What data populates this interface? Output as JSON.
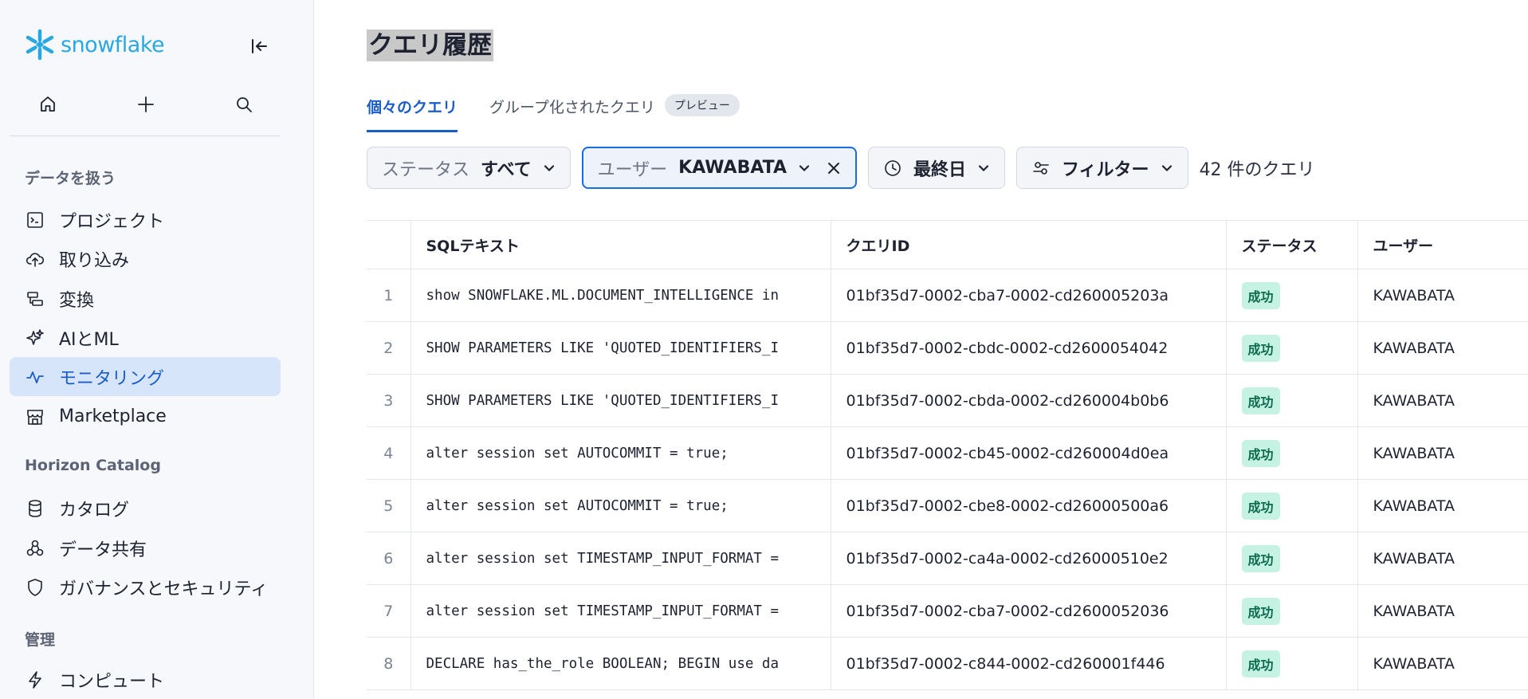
{
  "brand": {
    "name": "snowflake",
    "color": "#29a8e0"
  },
  "sidebar": {
    "quick_icons": [
      "home-icon",
      "plus-icon",
      "search-icon"
    ],
    "sections": [
      {
        "label": "データを扱う"
      },
      {
        "label": "Horizon Catalog"
      },
      {
        "label": "管理"
      }
    ],
    "items": [
      {
        "label": "プロジェクト",
        "icon": "terminal-icon"
      },
      {
        "label": "取り込み",
        "icon": "cloud-upload-icon"
      },
      {
        "label": "変換",
        "icon": "transform-icon"
      },
      {
        "label": "AIとML",
        "icon": "sparkle-icon"
      },
      {
        "label": "モニタリング",
        "icon": "activity-icon",
        "active": true
      },
      {
        "label": "Marketplace",
        "icon": "store-icon"
      },
      {
        "label": "カタログ",
        "icon": "database-icon"
      },
      {
        "label": "データ共有",
        "icon": "share-icon"
      },
      {
        "label": "ガバナンスとセキュリティ",
        "icon": "shield-icon"
      },
      {
        "label": "コンピュート",
        "icon": "lightning-icon"
      }
    ]
  },
  "page": {
    "title": "クエリ履歴"
  },
  "tabs": [
    {
      "label": "個々のクエリ",
      "active": true
    },
    {
      "label": "グループ化されたクエリ",
      "badge": "プレビュー"
    }
  ],
  "filters": {
    "status": {
      "key": "ステータス",
      "value": "すべて"
    },
    "user": {
      "key": "ユーザー",
      "value": "KAWABATA"
    },
    "date": {
      "value": "最終日"
    },
    "more": {
      "value": "フィルター"
    },
    "count": "42 件のクエリ"
  },
  "table": {
    "headers": {
      "sql": "SQLテキスト",
      "id": "クエリID",
      "status": "ステータス",
      "user": "ユーザー"
    },
    "rows": [
      {
        "n": "1",
        "sql": "show SNOWFLAKE.ML.DOCUMENT_INTELLIGENCE in",
        "id": "01bf35d7-0002-cba7-0002-cd260005203a",
        "status": "成功",
        "user": "KAWABATA"
      },
      {
        "n": "2",
        "sql": "SHOW PARAMETERS LIKE 'QUOTED_IDENTIFIERS_I",
        "id": "01bf35d7-0002-cbdc-0002-cd2600054042",
        "status": "成功",
        "user": "KAWABATA"
      },
      {
        "n": "3",
        "sql": "SHOW PARAMETERS LIKE 'QUOTED_IDENTIFIERS_I",
        "id": "01bf35d7-0002-cbda-0002-cd260004b0b6",
        "status": "成功",
        "user": "KAWABATA"
      },
      {
        "n": "4",
        "sql": "alter session set AUTOCOMMIT = true;",
        "id": "01bf35d7-0002-cb45-0002-cd260004d0ea",
        "status": "成功",
        "user": "KAWABATA"
      },
      {
        "n": "5",
        "sql": "alter session set AUTOCOMMIT = true;",
        "id": "01bf35d7-0002-cbe8-0002-cd26000500a6",
        "status": "成功",
        "user": "KAWABATA"
      },
      {
        "n": "6",
        "sql": "alter session set TIMESTAMP_INPUT_FORMAT =",
        "id": "01bf35d7-0002-ca4a-0002-cd26000510e2",
        "status": "成功",
        "user": "KAWABATA"
      },
      {
        "n": "7",
        "sql": "alter session set TIMESTAMP_INPUT_FORMAT =",
        "id": "01bf35d7-0002-cba7-0002-cd2600052036",
        "status": "成功",
        "user": "KAWABATA"
      },
      {
        "n": "8",
        "sql": "DECLARE has_the_role BOOLEAN; BEGIN use da",
        "id": "01bf35d7-0002-c844-0002-cd260001f446",
        "status": "成功",
        "user": "KAWABATA"
      }
    ]
  }
}
